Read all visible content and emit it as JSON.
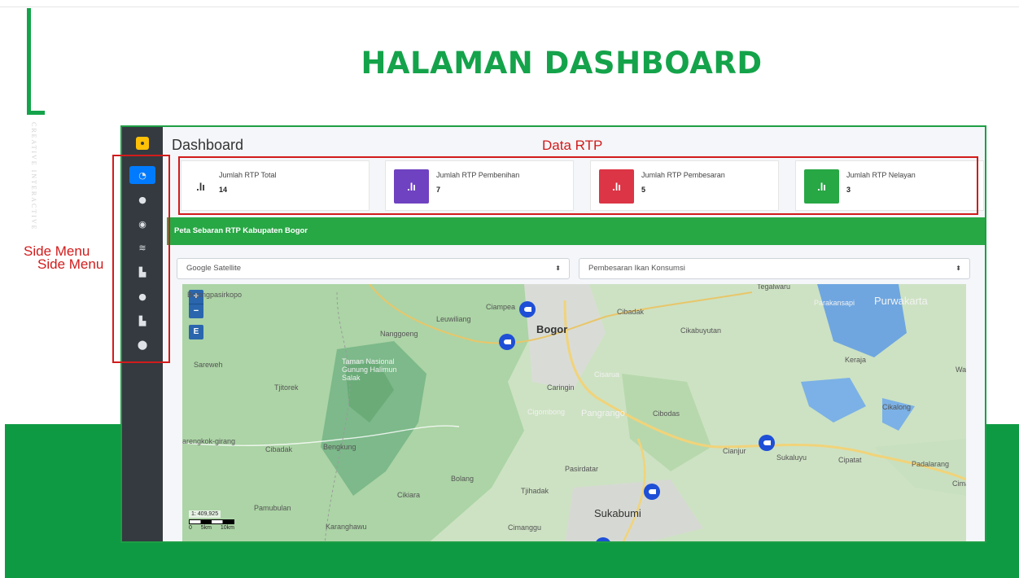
{
  "slide": {
    "title": "HALAMAN DASHBOARD",
    "vertical_text": "CREATIVE INTERACTIVE"
  },
  "app": {
    "page_heading": "Dashboard",
    "sidebar_icons": [
      "dashboard-icon",
      "user-icon",
      "circle-icon",
      "layers-icon",
      "file-icon",
      "user-icon",
      "chart-icon",
      "map-pin-icon"
    ],
    "cards": [
      {
        "label": "Jumlah RTP Total",
        "value": "14",
        "color": "#ffffff",
        "icon": "chart-icon"
      },
      {
        "label": "Jumlah RTP Pembenihan",
        "value": "7",
        "color": "#6f42c1",
        "icon": "chart-icon"
      },
      {
        "label": "Jumlah RTP Pembesaran",
        "value": "5",
        "color": "#dc3545",
        "icon": "chart-icon"
      },
      {
        "label": "Jumlah RTP Nelayan",
        "value": "3",
        "color": "#28a745",
        "icon": "chart-icon"
      }
    ],
    "map_section_title": "Peta Sebaran RTP Kabupaten Bogor",
    "basemap_select": "Google Satellite",
    "category_select": "Pembesaran Ikan Konsumsi",
    "map": {
      "zoom_in": "+",
      "zoom_out": "−",
      "layer_button": "E",
      "scale_ratio": "1: 409,925",
      "scale_units": [
        "0",
        "5km",
        "10km"
      ],
      "places": [
        "Bojongpasirkopo",
        "Leuwiliang",
        "Ciampea",
        "Bogor",
        "Cibadak",
        "Tegalwaru",
        "Parakansapi",
        "Purwakarta",
        "Nanggoeng",
        "Cikabuyutan",
        "Sareweh",
        "Tjitorek",
        "Taman Nasional Gunung Halimun Salak",
        "Caringin",
        "Cisarua",
        "Keraja",
        "Cigombong",
        "Pangrango",
        "Cibodas",
        "Cikalong",
        "arengkok-girang",
        "Cibadak",
        "Bengkung",
        "Cianjur",
        "Sukaluyu",
        "Cipatat",
        "Padalarang",
        "Pasirdatar",
        "Bolang",
        "Cikiara",
        "Tjihadak",
        "Pamubulan",
        "Sukabumi",
        "Karanghawu",
        "Cimanggu",
        "Cima",
        "Wa"
      ]
    }
  },
  "annotations": {
    "data_rtp": "Data RTP",
    "side_menu_1": "Side Menu",
    "side_menu_2": "Side Menu"
  },
  "colors": {
    "brand_green": "#14a34a",
    "band_green": "#0e9a43",
    "sidebar": "#343a40",
    "annotation_red": "#d21b1b",
    "marker_blue": "#1e4fd6"
  }
}
